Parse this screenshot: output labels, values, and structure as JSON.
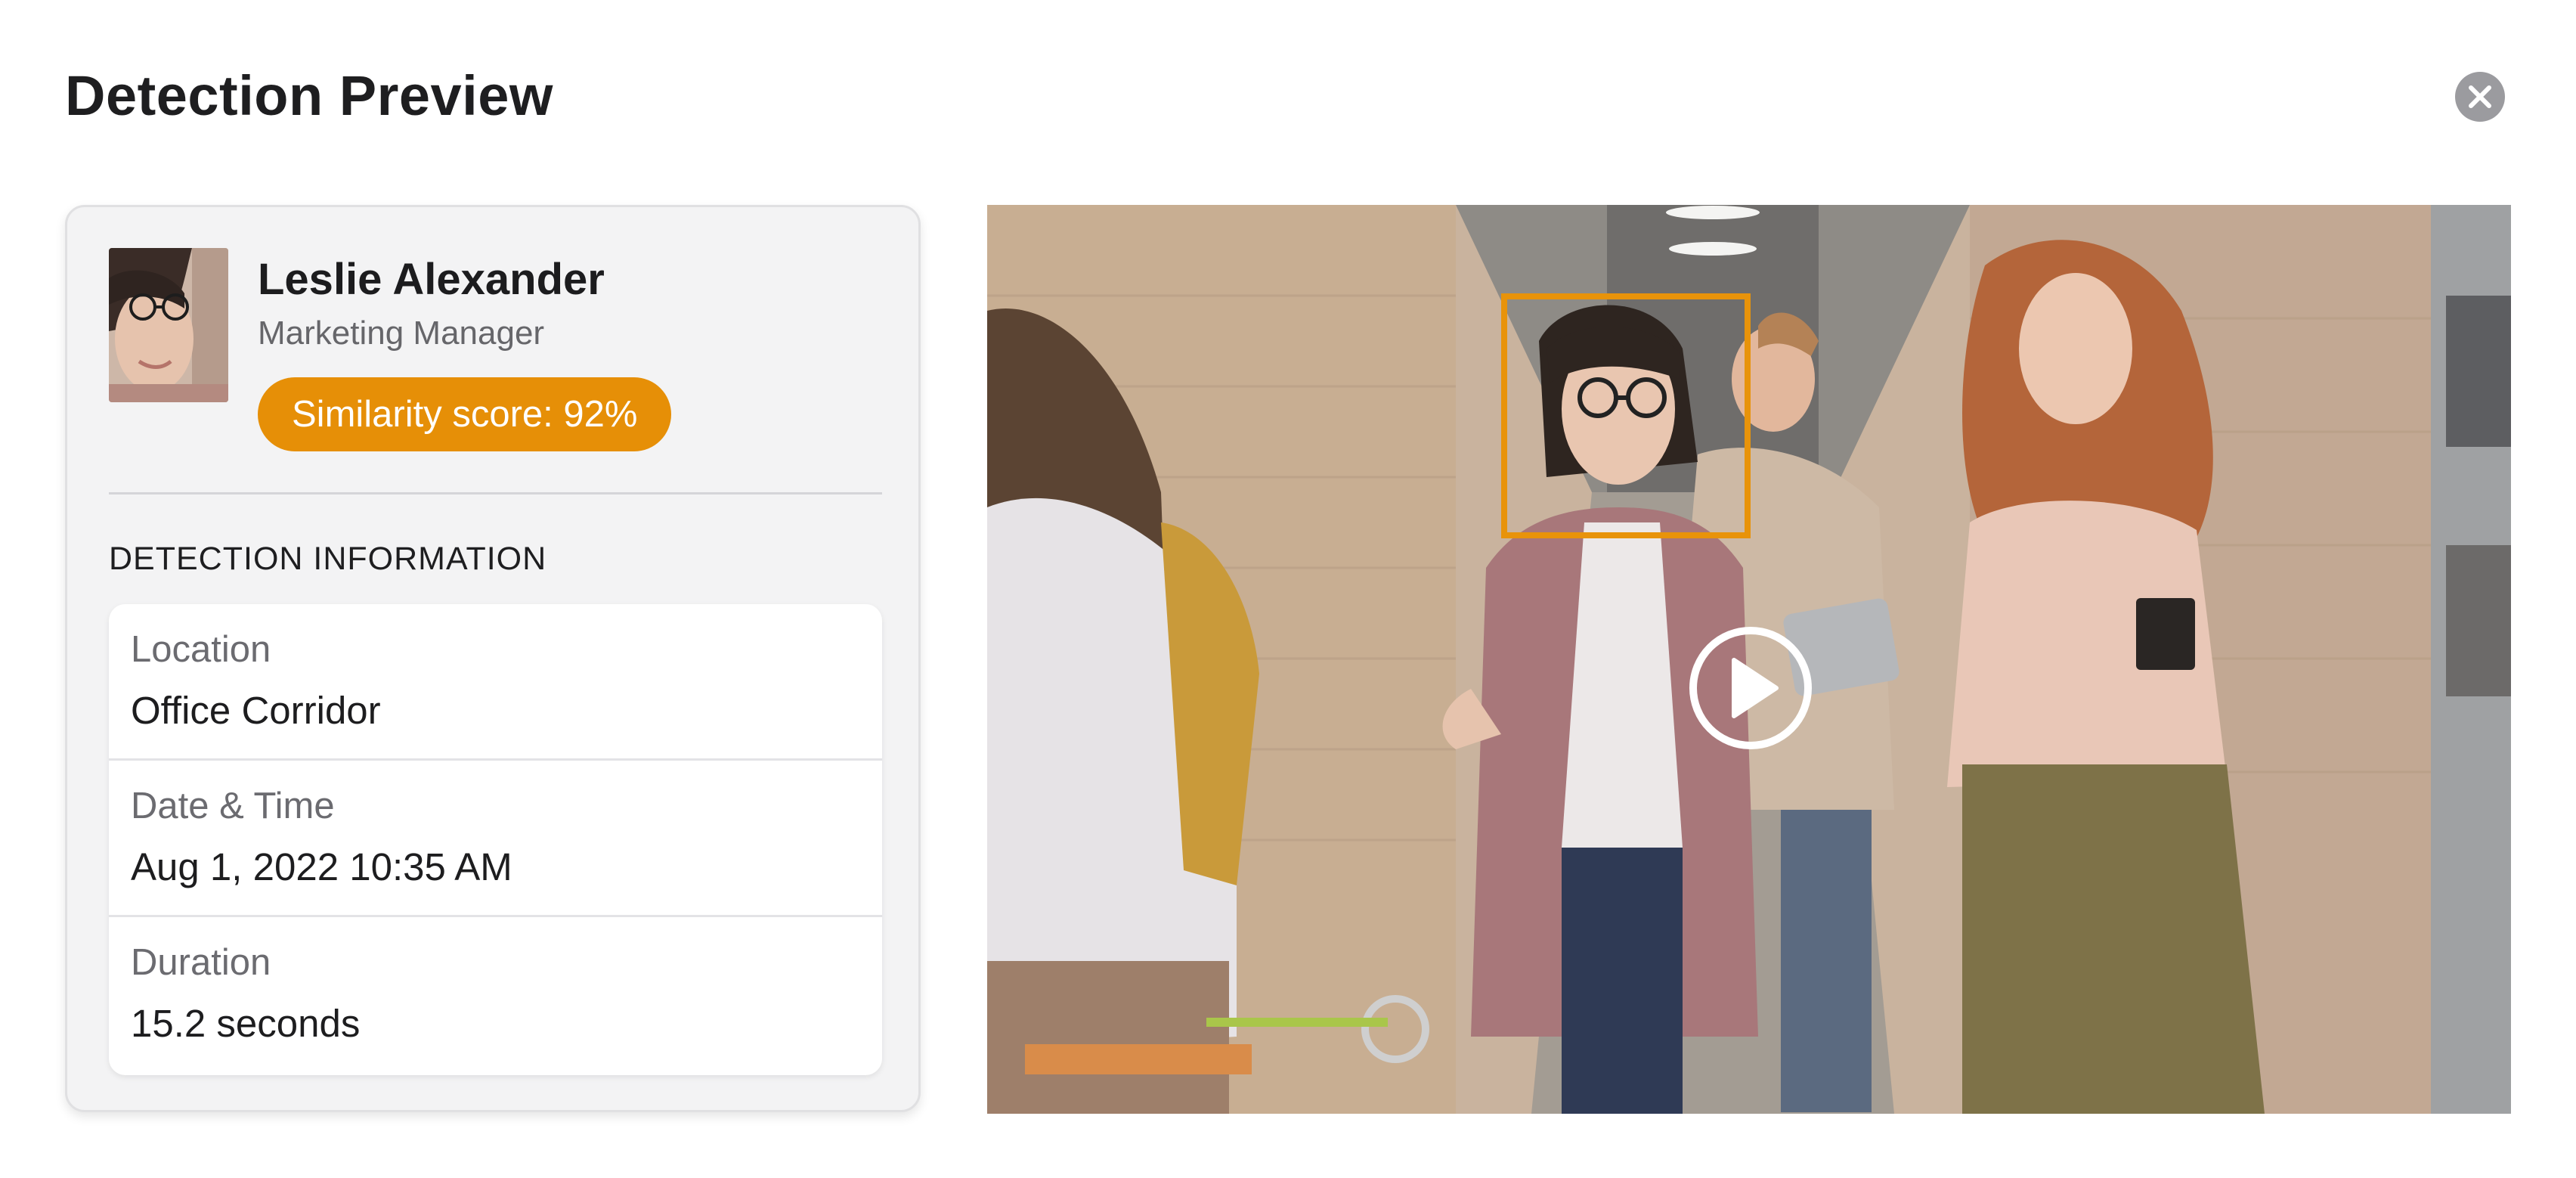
{
  "dialog": {
    "title": "Detection Preview"
  },
  "profile": {
    "name": "Leslie Alexander",
    "role": "Marketing Manager",
    "similarity_label": "Similarity score: 92%",
    "similarity_score": 0.92
  },
  "detection": {
    "heading": "DETECTION INFORMATION",
    "rows": [
      {
        "label": "Location",
        "value": "Office Corridor"
      },
      {
        "label": "Date & Time",
        "value": "Aug 1, 2022 10:35 AM"
      },
      {
        "label": "Duration",
        "value": "15.2 seconds"
      }
    ]
  },
  "icons": {
    "close": "close-icon",
    "play": "play-icon"
  },
  "colors": {
    "accent": "#e68f07",
    "close_button": "#9b9b9f",
    "card_background": "#f3f3f4"
  }
}
